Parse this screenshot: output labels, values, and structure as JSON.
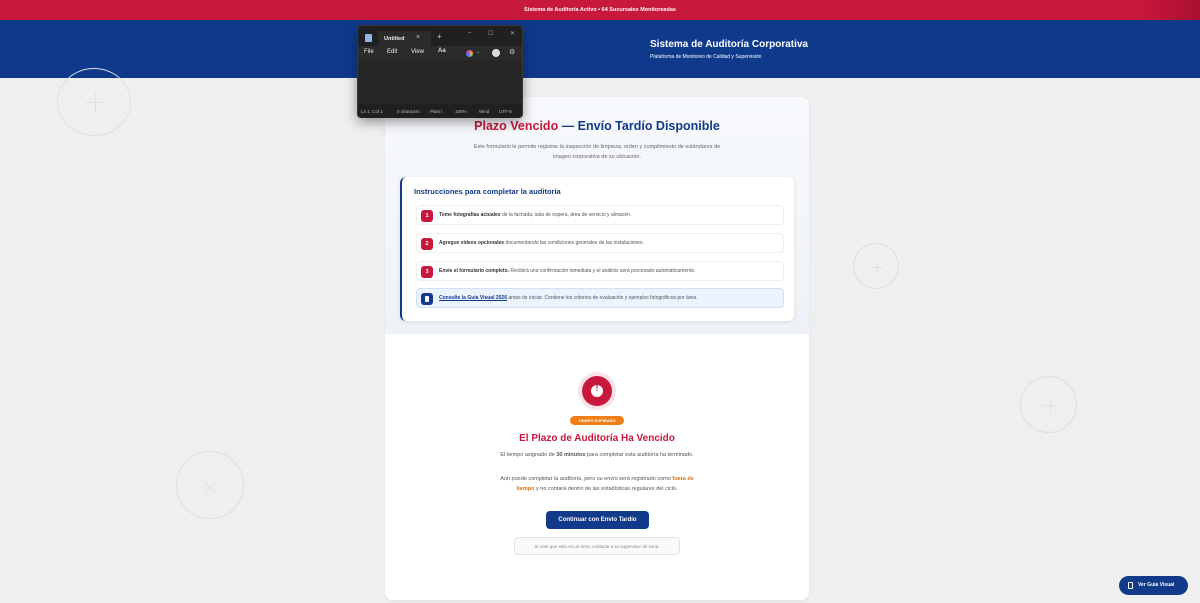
{
  "topbar": {
    "text": "Sistema de Auditoría Activo • 64 Sucursales Monitoreadas"
  },
  "header": {
    "title": "Sistema de Auditoría Corporativa",
    "subtitle": "Plataforma de Monitoreo de Calidad y Supervisión"
  },
  "card": {
    "title_red": "Plazo Vencido",
    "title_blue": "— Envío Tardío Disponible",
    "description": "Este formulario le permite registrar la inspección de limpieza, orden y cumplimiento de estándares de imagen corporativa de su ubicación.",
    "instructions": {
      "title": "Instrucciones para completar la auditoría",
      "steps": [
        {
          "number": "1",
          "bold": "Tome fotografías actuales",
          "text": " de la fachada, sala de espera, área de servicio y almacén."
        },
        {
          "number": "2",
          "bold": "Agregue videos opcionales",
          "text": " documentando las condiciones generales de las instalaciones."
        },
        {
          "number": "3",
          "bold": "Envíe el formulario completo.",
          "text": " Recibirá una confirmación inmediata y el análisis será procesado automáticamente."
        }
      ],
      "guide_link": "Consulte la Guía Visual 2026",
      "guide_text": " antes de iniciar. Contiene los criterios de evaluación y ejemplos fotográficos por área."
    },
    "expired": {
      "badge": "TIEMPO EXPIRADO",
      "title": "El Plazo de Auditoría Ha Vencido",
      "p1_before": "El tiempo asignado de ",
      "p1_bold": "30 minutos",
      "p1_after": " para completar esta auditoría ha terminado.",
      "p2_before": "Aún puede completar la auditoría, pero su envío será registrado como ",
      "p2_highlight": "fuera de tiempo",
      "p2_after": " y no contará dentro de las estadísticas regulares del ciclo.",
      "button": "Continuar con Envío Tardío",
      "contact": "Si cree que esto es un error, contacte a su supervisor de zona."
    }
  },
  "fab": {
    "label": "Ver Guía Visual"
  },
  "notepad": {
    "tab_title": "Untitled",
    "tab_close": "×",
    "new_tab": "+",
    "window_min": "–",
    "window_max": "☐",
    "window_close": "✕",
    "menu": [
      "File",
      "Edit",
      "View"
    ],
    "format_icon": "Aa",
    "chevron": "⌄",
    "gear": "⚙",
    "status": {
      "position": "Ln 1, Col 1",
      "chars": "0 character:",
      "format": "Plain t",
      "zoom": "100%",
      "line_ending": "Wind",
      "encoding": "UTF-8"
    }
  },
  "colors": {
    "primary_red": "#c8183c",
    "primary_blue": "#123a8a",
    "badge_orange": "#f07e17"
  }
}
